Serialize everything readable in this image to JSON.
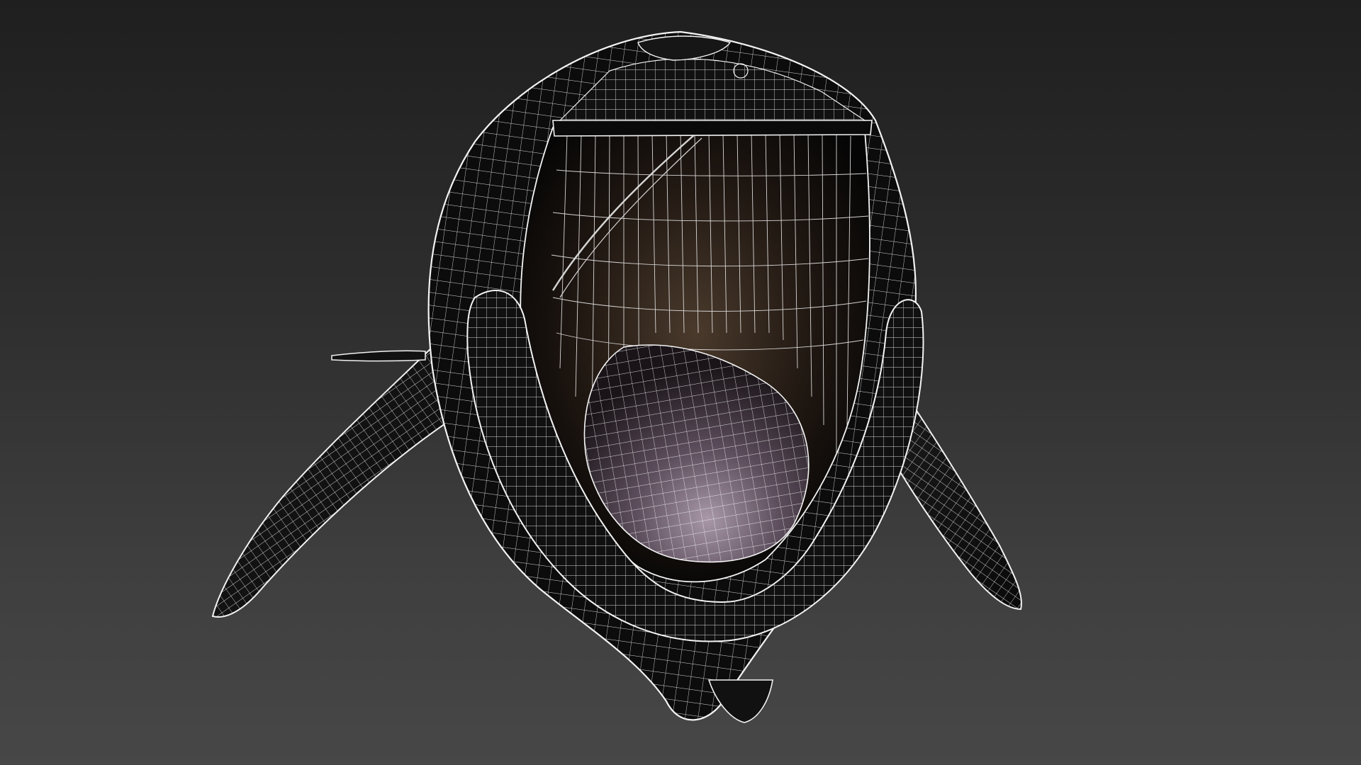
{
  "viewport": {
    "background_top": "#1f1f1f",
    "background_bottom": "#474747",
    "wire_color": "#f2f2f2"
  },
  "model": {
    "subject": "whale-head-wireframe"
  }
}
